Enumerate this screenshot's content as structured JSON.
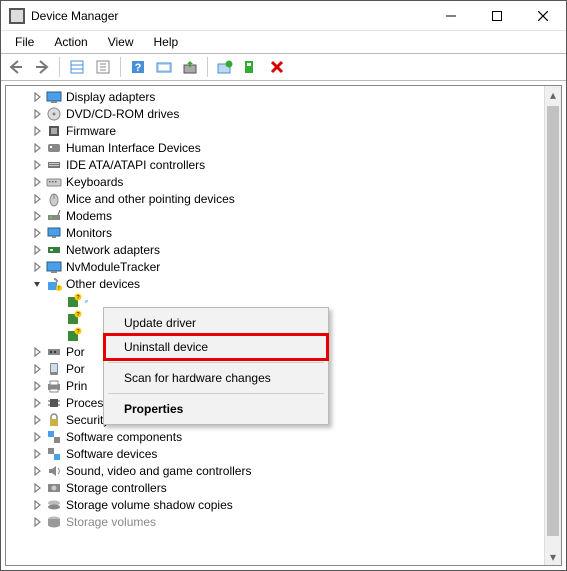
{
  "window": {
    "title": "Device Manager"
  },
  "menubar": [
    "File",
    "Action",
    "View",
    "Help"
  ],
  "toolbar_icons": [
    "back-icon",
    "forward-icon",
    "show-hidden-icon",
    "properties-icon",
    "help-icon",
    "scan-icon",
    "update-driver-icon",
    "add-legacy-icon",
    "uninstall-icon",
    "disable-icon"
  ],
  "tree": {
    "categories": [
      {
        "label": "Display adapters",
        "icon": "display-adapters-icon",
        "expandable": true,
        "expanded": false
      },
      {
        "label": "DVD/CD-ROM drives",
        "icon": "dvd-icon",
        "expandable": true,
        "expanded": false
      },
      {
        "label": "Firmware",
        "icon": "firmware-icon",
        "expandable": true,
        "expanded": false
      },
      {
        "label": "Human Interface Devices",
        "icon": "hid-icon",
        "expandable": true,
        "expanded": false
      },
      {
        "label": "IDE ATA/ATAPI controllers",
        "icon": "ide-icon",
        "expandable": true,
        "expanded": false
      },
      {
        "label": "Keyboards",
        "icon": "keyboard-icon",
        "expandable": true,
        "expanded": false
      },
      {
        "label": "Mice and other pointing devices",
        "icon": "mouse-icon",
        "expandable": true,
        "expanded": false
      },
      {
        "label": "Modems",
        "icon": "modem-icon",
        "expandable": true,
        "expanded": false
      },
      {
        "label": "Monitors",
        "icon": "monitor-icon",
        "expandable": true,
        "expanded": false
      },
      {
        "label": "Network adapters",
        "icon": "network-icon",
        "expandable": true,
        "expanded": false
      },
      {
        "label": "NvModuleTracker",
        "icon": "nvmodule-icon",
        "expandable": true,
        "expanded": false
      },
      {
        "label": "Other devices",
        "icon": "other-devices-icon",
        "expandable": true,
        "expanded": true,
        "children": [
          {
            "label": "",
            "icon": "unknown-device-icon",
            "selected": true
          },
          {
            "label": "",
            "icon": "unknown-device-icon"
          },
          {
            "label": "",
            "icon": "unknown-device-icon"
          }
        ]
      },
      {
        "label": "Por",
        "icon": "ports-icon",
        "expandable": true,
        "expanded": false,
        "truncated": true
      },
      {
        "label": "Por",
        "icon": "portable-icon",
        "expandable": true,
        "expanded": false,
        "truncated": true
      },
      {
        "label": "Prin",
        "icon": "print-icon",
        "expandable": true,
        "expanded": false,
        "truncated": true
      },
      {
        "label": "Processors",
        "icon": "cpu-icon",
        "expandable": true,
        "expanded": false
      },
      {
        "label": "Security devices",
        "icon": "security-icon",
        "expandable": true,
        "expanded": false
      },
      {
        "label": "Software components",
        "icon": "software-comp-icon",
        "expandable": true,
        "expanded": false
      },
      {
        "label": "Software devices",
        "icon": "software-dev-icon",
        "expandable": true,
        "expanded": false
      },
      {
        "label": "Sound, video and game controllers",
        "icon": "sound-icon",
        "expandable": true,
        "expanded": false
      },
      {
        "label": "Storage controllers",
        "icon": "storage-ctrl-icon",
        "expandable": true,
        "expanded": false
      },
      {
        "label": "Storage volume shadow copies",
        "icon": "shadow-icon",
        "expandable": true,
        "expanded": false
      },
      {
        "label": "Storage volumes",
        "icon": "storage-vol-icon",
        "expandable": true,
        "expanded": false,
        "cutoff": true
      }
    ]
  },
  "context_menu": {
    "items": [
      {
        "label": "Update driver",
        "type": "item"
      },
      {
        "label": "Uninstall device",
        "type": "item",
        "highlighted": true
      },
      {
        "type": "sep"
      },
      {
        "label": "Scan for hardware changes",
        "type": "item"
      },
      {
        "type": "sep"
      },
      {
        "label": "Properties",
        "type": "item",
        "bold": true
      }
    ]
  },
  "colors": {
    "highlight_border": "#e60000",
    "selection_bg": "#cce8ff"
  }
}
